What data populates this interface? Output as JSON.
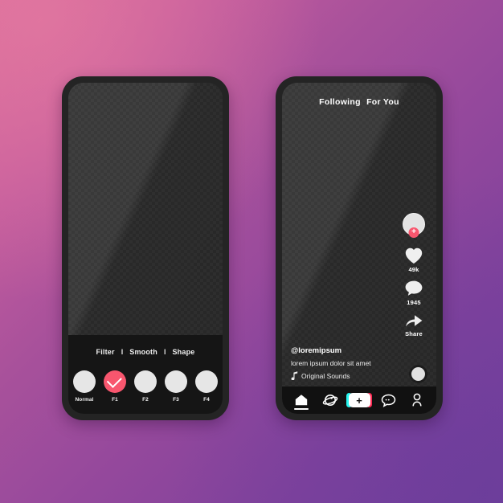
{
  "background": {
    "gradient_from": "#d8699c",
    "gradient_to": "#74409b"
  },
  "accent": {
    "red": "#f8566e",
    "cyan": "#25f4ee",
    "pink": "#fe2c55"
  },
  "left_phone": {
    "tabs": [
      {
        "label": "Filter"
      },
      {
        "label": "Smooth"
      },
      {
        "label": "Shape"
      }
    ],
    "separator": "I",
    "filters": [
      {
        "label": "Normal",
        "selected": false
      },
      {
        "label": "F1",
        "selected": true
      },
      {
        "label": "F2",
        "selected": false
      },
      {
        "label": "F3",
        "selected": false
      },
      {
        "label": "F4",
        "selected": false
      }
    ]
  },
  "right_phone": {
    "header": {
      "following": "Following",
      "for_you": "For You"
    },
    "rail": {
      "avatar_badge": "+",
      "like_count": "49k",
      "comment_count": "1945",
      "share_label": "Share"
    },
    "caption": {
      "handle": "@loremipsum",
      "text": "lorem ipsum dolor sit amet",
      "music": "Original Sounds"
    },
    "navbar": [
      {
        "name": "home",
        "label": "",
        "active": true
      },
      {
        "name": "discover",
        "label": "",
        "active": false
      },
      {
        "name": "create",
        "label": "+",
        "active": false
      },
      {
        "name": "inbox",
        "label": "",
        "active": false
      },
      {
        "name": "profile",
        "label": "",
        "active": false
      }
    ]
  }
}
